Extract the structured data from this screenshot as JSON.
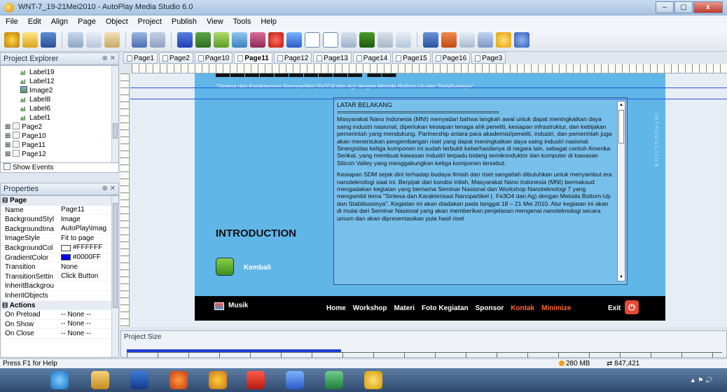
{
  "window": {
    "title": "WNT-7_19-21Mei2010 - AutoPlay Media Studio 6.0",
    "min": "–",
    "max": "▢",
    "close": "x"
  },
  "menu": [
    "File",
    "Edit",
    "Align",
    "Page",
    "Object",
    "Project",
    "Publish",
    "View",
    "Tools",
    "Help"
  ],
  "explorer": {
    "title": "Project Explorer",
    "items": [
      {
        "label": "Label19",
        "kind": "label"
      },
      {
        "label": "Label12",
        "kind": "label"
      },
      {
        "label": "Image2",
        "kind": "image"
      },
      {
        "label": "Label8",
        "kind": "label"
      },
      {
        "label": "Label6",
        "kind": "label"
      },
      {
        "label": "Label1",
        "kind": "label"
      },
      {
        "label": "Page2",
        "kind": "page"
      },
      {
        "label": "Page10",
        "kind": "page"
      },
      {
        "label": "Page11",
        "kind": "page"
      },
      {
        "label": "Page12",
        "kind": "page"
      }
    ],
    "show_events": "Show Events"
  },
  "properties": {
    "title": "Properties",
    "group_page": "Page",
    "rows": [
      {
        "k": "Name",
        "v": "Page11"
      },
      {
        "k": "BackgroundStyl",
        "v": "Image"
      },
      {
        "k": "BackgroundIma",
        "v": "AutoPlay\\Imag"
      },
      {
        "k": "ImageStyle",
        "v": "Fit to page"
      },
      {
        "k": "BackgroundCol",
        "v": "#FFFFFF",
        "swatch": "#FFFFFF"
      },
      {
        "k": "GradientColor",
        "v": "#0000FF",
        "swatch": "#0000FF"
      },
      {
        "k": "Transition",
        "v": "None"
      },
      {
        "k": "TransitionSettin",
        "v": "Click Button"
      },
      {
        "k": "InheritBackgrou",
        "v": ""
      },
      {
        "k": "InheritObjects",
        "v": ""
      }
    ],
    "group_actions": "Actions",
    "actions": [
      {
        "k": "On Preload",
        "v": "-- None --"
      },
      {
        "k": "On Show",
        "v": "-- None --"
      },
      {
        "k": "On Close",
        "v": "-- None --"
      }
    ]
  },
  "tabs": [
    "Page1",
    "Page2",
    "Page10",
    "Page11",
    "Page12",
    "Page13",
    "Page14",
    "Page15",
    "Page16",
    "Page3"
  ],
  "active_tab": "Page11",
  "page_content": {
    "subtitle": "\"Sintesa dan Karakterisasi Nanopartikel (Fe3O4 dan Ag) dengan Metoda Bottom-Up dan Stabilisasinya\"",
    "intro": "INTRODUCTION",
    "kembali": "Kembali",
    "side_vertical": "INTRODUCTION",
    "text_title": "LATAR BELAKANG",
    "text_rule": "===============================================================",
    "paragraph1": "Masyarakat Nano Indonesia (MNI) menyadari bahwa langkah awal untuk dapat meningkatkan daya saing industri nasional, diperlukan kesiapan tenaga ahli peneliti, kesiapan infrastruktur, dan kebijakan pemerintah yang mendukung. Partnership antara para akademisi/peneliti, industri, dan pemerintah juga akan menentukan pengembangan riset yang dapat meningkatkan daya saing industri nasional. Sinergisitas ketiga komponen ini sudah terbukti keberhasilanya di negara lain, sebagai contoh Amerika Serikat, yang membuat kawasan industri terpadu bidang semikonduktor dan komputer di kawasan Silicon Valley yang menggabungkan ketiga komponen tersebut.",
    "paragraph2": "Kesiapan SDM sejak dini terhadap budaya Ilmiah dan riset sangatlah dibutuhkan untuk menyambut era nanoteknologi saat ini. Berpijak dari kondisi inilah, Masyarakat Nano Indonesia (MNI) bermaksud mengadakan kegiatan yang bernama Seminar Nasional dan Workshop Nanoteknologi 7 yang mengambil tema \"Sintesa dan Karakterisasi Nanopartikel (. Fe3O4 dan Ag) dengan Metoda Bottom-Up dan Stabilisasinya\". Kegiatan ini akan diadakan pada tanggal 18 – 21 Mei 2010. Alur kegiatan ini akan di mulai dari Seminar Nasional yang akan memberikan penjelasan mengenai nanoteknologi secara umum dan akan dipresentasikan pula hasil riset",
    "musik": "Musik",
    "nav": [
      {
        "label": "Home",
        "hot": false
      },
      {
        "label": "Workshop",
        "hot": false
      },
      {
        "label": "Materi",
        "hot": false
      },
      {
        "label": "Foto Kegiatan",
        "hot": false
      },
      {
        "label": "Sponsor",
        "hot": false
      },
      {
        "label": "Kontak",
        "hot": true
      },
      {
        "label": "Minimize",
        "hot": true
      }
    ],
    "exit": "Exit"
  },
  "project_size": {
    "label": "Project Size",
    "used_fraction": 0.36
  },
  "status": {
    "help": "Press F1 for Help",
    "memory": "280 MB",
    "size": "847,421"
  }
}
